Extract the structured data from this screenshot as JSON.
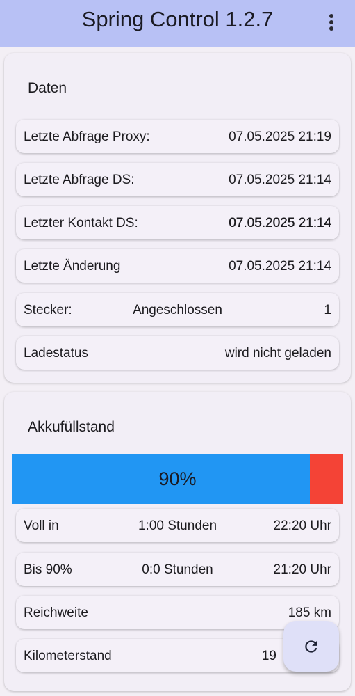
{
  "app_bar": {
    "title": "Spring Control 1.2.7",
    "menu_icon": "more-vert-icon"
  },
  "daten": {
    "title": "Daten",
    "rows": [
      {
        "label": "Letzte Abfrage Proxy:",
        "value": "07.05.2025 21:19"
      },
      {
        "label": "Letzte Abfrage DS:",
        "value": "07.05.2025 21:14"
      },
      {
        "label": "Letzter Kontakt DS:",
        "value": "07.05.2025 21:14"
      },
      {
        "label": "Letzte Änderung",
        "value": "07.05.2025 21:14"
      },
      {
        "label": "Stecker:",
        "middle": "Angeschlossen",
        "value": "1"
      },
      {
        "label": "Ladestatus",
        "value": "wird nicht geladen"
      }
    ]
  },
  "akku": {
    "title": "Akkufüllstand",
    "percent_label": "90%",
    "level": 0.9,
    "fill_color": "#2196f3",
    "empty_color": "#f44336",
    "rows": [
      {
        "label": "Voll in",
        "middle": "1:00 Stunden",
        "value": "22:20 Uhr"
      },
      {
        "label": "Bis 90%",
        "middle": "0:0 Stunden",
        "value": "21:20 Uhr"
      },
      {
        "label": "Reichweite",
        "value": "185 km"
      },
      {
        "label": "Kilometerstand",
        "value": "19"
      }
    ]
  },
  "fab": {
    "icon": "refresh-icon"
  },
  "colors": {
    "app_bar": "#b8c1f5",
    "background": "#f3eff5",
    "fab": "#dfe0f8"
  }
}
